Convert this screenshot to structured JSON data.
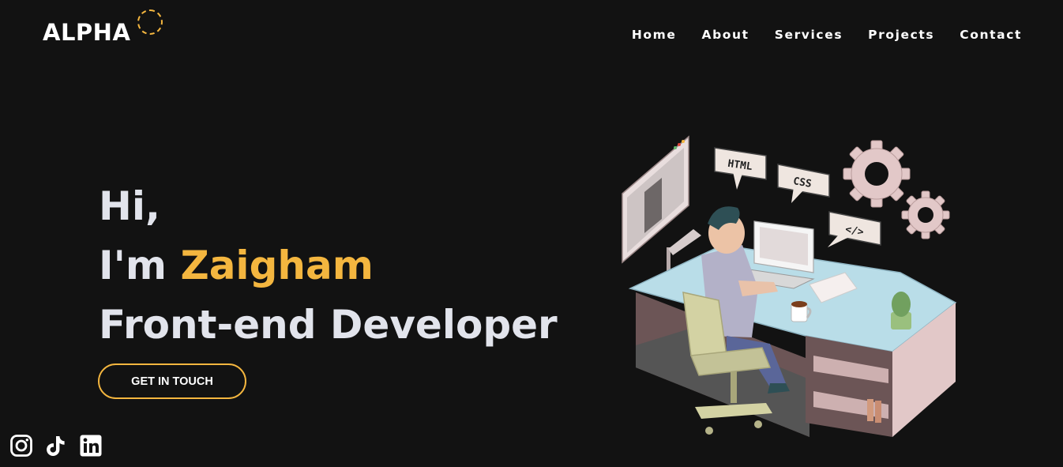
{
  "header": {
    "logo": "ALPHA",
    "nav": [
      "Home",
      "About",
      "Services",
      "Projects",
      "Contact"
    ]
  },
  "hero": {
    "greeting": "Hi,",
    "intro_prefix": "I'm",
    "name": "Zaigham",
    "role": "Front-end Developer",
    "cta_label": "GET IN TOUCH"
  },
  "illustration": {
    "bubbles": [
      "HTML",
      "CSS",
      "</>"
    ]
  },
  "social": [
    "instagram-icon",
    "tiktok-icon",
    "linkedin-icon"
  ],
  "colors": {
    "background": "#121212",
    "accent": "#f4b63f",
    "text": "#e2e4ec"
  }
}
